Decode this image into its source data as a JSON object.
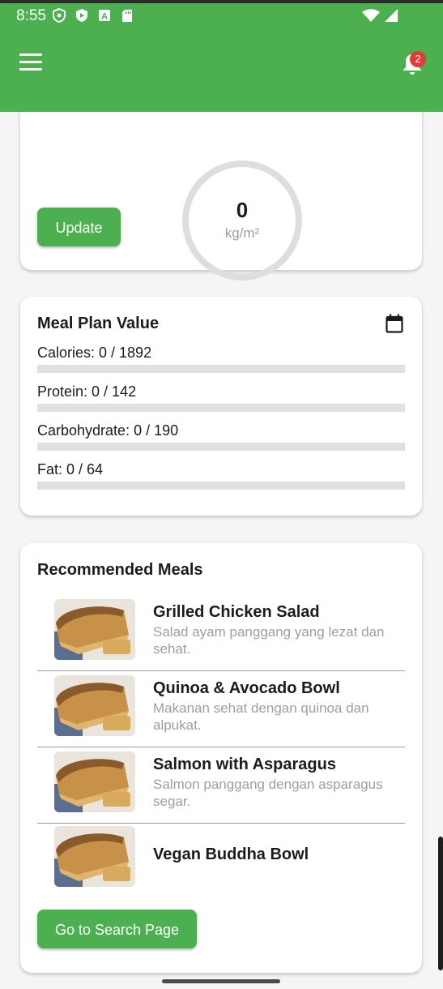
{
  "status_bar": {
    "time": "8:55",
    "icons": [
      "shield-icon",
      "play-protect-icon",
      "text-a-icon",
      "sd-card-icon"
    ],
    "right_icons": [
      "wifi-icon",
      "signal-icon"
    ]
  },
  "app_bar": {
    "menu_icon": "hamburger-menu-icon",
    "notification_icon": "bell-icon",
    "notification_count": "2",
    "color": "#4caf50"
  },
  "bmi": {
    "value": "0",
    "unit": "kg/m²",
    "update_label": "Update"
  },
  "meal_plan": {
    "title": "Meal Plan Value",
    "calendar_icon": "calendar-icon",
    "nutrients": [
      {
        "label": "Calories: 0 / 1892",
        "progress": 0
      },
      {
        "label": "Protein: 0 / 142",
        "progress": 0
      },
      {
        "label": "Carbohydrate: 0 / 190",
        "progress": 0
      },
      {
        "label": "Fat: 0 / 64",
        "progress": 0
      }
    ]
  },
  "recommended": {
    "title": "Recommended Meals",
    "meals": [
      {
        "name": "Grilled Chicken Salad",
        "description": "Salad ayam panggang yang lezat dan sehat."
      },
      {
        "name": "Quinoa & Avocado Bowl",
        "description": "Makanan sehat dengan quinoa dan alpukat."
      },
      {
        "name": "Salmon with Asparagus",
        "description": "Salmon panggang dengan asparagus segar."
      },
      {
        "name": "Vegan Buddha Bowl",
        "description": ""
      }
    ],
    "search_button_label": "Go to Search Page"
  }
}
